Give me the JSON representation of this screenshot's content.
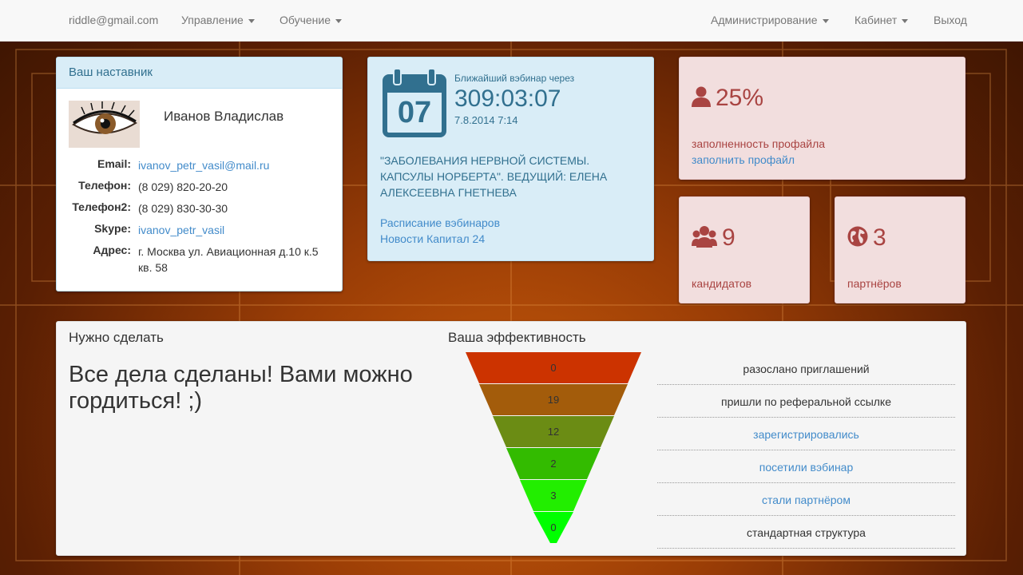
{
  "navbar": {
    "user_email": "riddle@gmail.com",
    "menu_manage": "Управление",
    "menu_learning": "Обучение",
    "menu_admin": "Администрирование",
    "menu_cabinet": "Кабинет",
    "logout": "Выход"
  },
  "mentor": {
    "heading": "Ваш наставник",
    "name": "Иванов Владислав",
    "email_label": "Email:",
    "email": "ivanov_petr_vasil@mail.ru",
    "phone_label": "Телефон:",
    "phone": "(8 029) 820-20-20",
    "phone2_label": "Телефон2:",
    "phone2": "(8 029) 830-30-30",
    "skype_label": "Skype:",
    "skype": "ivanov_petr_vasil",
    "address_label": "Адрес:",
    "address": "г. Москва ул. Авиационная д.10 к.5 кв. 58"
  },
  "webinar": {
    "calendar_day": "07",
    "caption": "Ближайший вэбинар через",
    "timer": "309:03:07",
    "date": "7.8.2014 7:14",
    "title": "\"ЗАБОЛЕВАНИЯ НЕРВНОЙ СИСТЕМЫ. КАПСУЛЫ НОРБЕРТА\". ВЕДУЩИЙ: ЕЛЕНА АЛЕКСЕЕВНА ГНЕТНЕВА",
    "schedule_link": "Расписание вэбинаров",
    "news_link": "Новости Капитал 24"
  },
  "profile": {
    "percent": "25%",
    "fill_level": 0.25,
    "caption": "заполненность профайла",
    "fill_link": "заполнить профайл"
  },
  "candidates": {
    "count": "9",
    "caption": "кандидатов"
  },
  "partners": {
    "count": "3",
    "caption": "партнёров"
  },
  "todo": {
    "heading": "Нужно сделать",
    "message": "Все дела сделаны! Вами можно гордиться! ;)"
  },
  "efficiency": {
    "heading": "Ваша эффективность",
    "colors": [
      "#cc3300",
      "#a35c0b",
      "#6b8c14",
      "#33bb00",
      "#22ee00",
      "#00ff00"
    ],
    "legend": [
      {
        "label": "разослано приглашений",
        "value": "0",
        "link": false
      },
      {
        "label": "пришли по реферальной ссылке",
        "value": "19",
        "link": false
      },
      {
        "label": "зарегистрировались",
        "value": "12",
        "link": true
      },
      {
        "label": "посетили вэбинар",
        "value": "2",
        "link": true
      },
      {
        "label": "стали партнёром",
        "value": "3",
        "link": true
      },
      {
        "label": "стандартная структура",
        "value": "0",
        "link": false
      }
    ]
  }
}
